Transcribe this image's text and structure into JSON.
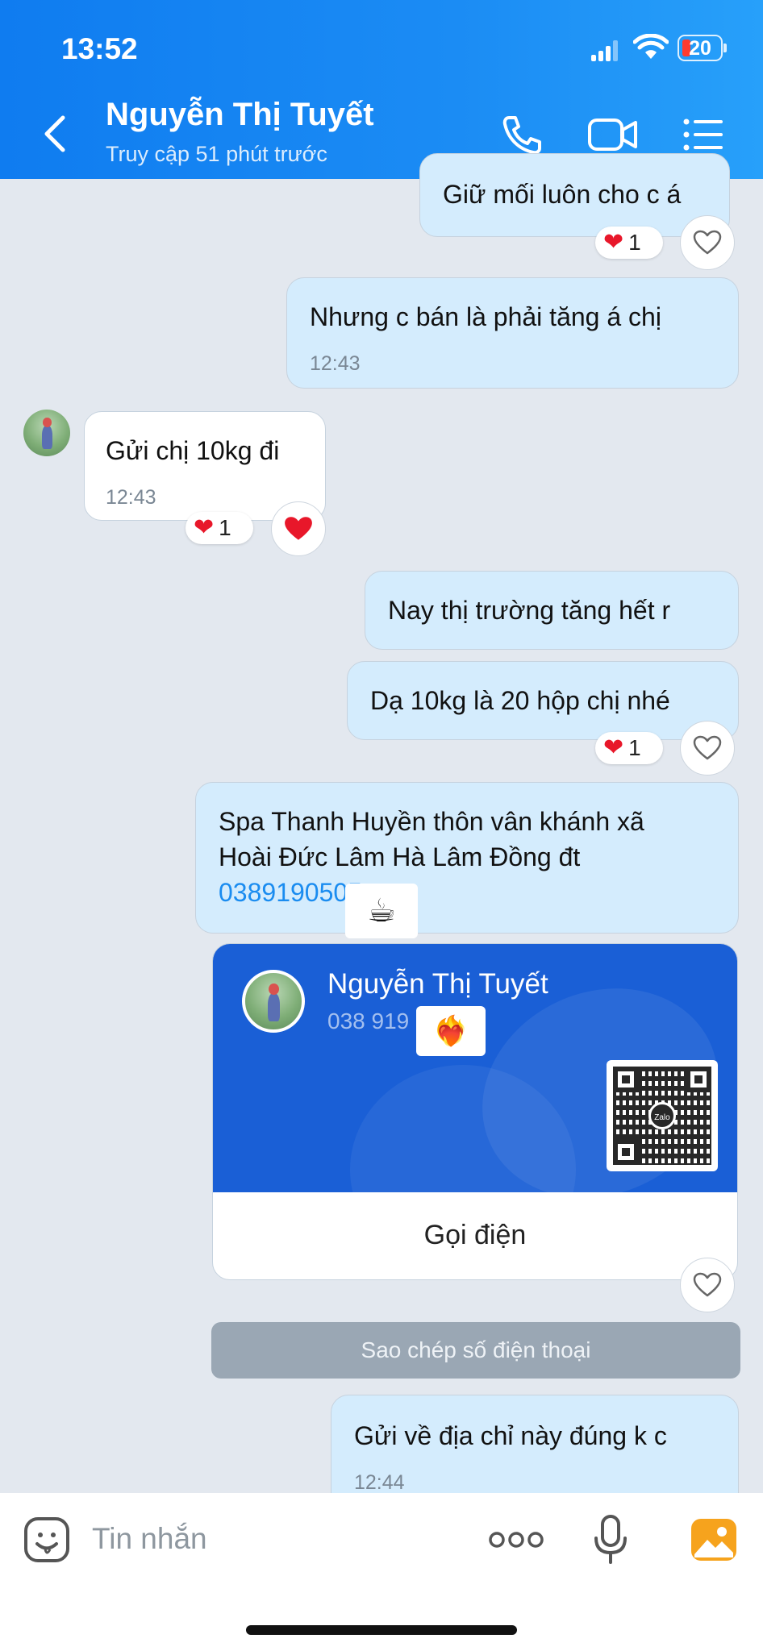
{
  "status_bar": {
    "time": "13:52",
    "battery": "20"
  },
  "header": {
    "contact_name": "Nguyễn Thị Tuyết",
    "contact_status": "Truy cập 51 phút trước",
    "icons": [
      "back-icon",
      "phone-icon",
      "video-icon",
      "menu-icon"
    ]
  },
  "messages": [
    {
      "direction": "outgoing",
      "text": "Giữ mối luôn cho c á",
      "reaction_count": "1"
    },
    {
      "direction": "outgoing",
      "text": "Nhưng c bán là phải tăng á chị",
      "time": "12:43"
    },
    {
      "direction": "incoming",
      "text": "Gửi chị 10kg đi",
      "time": "12:43",
      "reaction_count": "1"
    },
    {
      "direction": "outgoing",
      "text": "Nay thị trường tăng hết r"
    },
    {
      "direction": "outgoing",
      "text": "Dạ 10kg là 20 hộp chị nhé",
      "reaction_count": "1"
    },
    {
      "direction": "outgoing",
      "line1": "Spa Thanh Huyền thôn vân khánh xã",
      "line2": "Hoài Đức Lâm Hà Lâm Đồng đt",
      "phone": "0389190505",
      "sticker": "☕"
    },
    {
      "direction": "outgoing",
      "text": "Gửi về địa chỉ này đúng k c",
      "time": "12:44"
    }
  ],
  "contact_card": {
    "name": "Nguyễn Thị Tuyết",
    "phone": "038 919",
    "sticker": "❤️‍🔥",
    "qr_logo": "Zalo",
    "call_label": "Gọi điện"
  },
  "copy_button": "Sao chép số điện thoại",
  "input": {
    "placeholder": "Tin nhắn"
  },
  "colors": {
    "header": "#1b8cf4",
    "outgoing_bubble": "#d4ecfd",
    "heart": "#e8172a",
    "card": "#1a5fd6",
    "link": "#1a8cf0"
  }
}
